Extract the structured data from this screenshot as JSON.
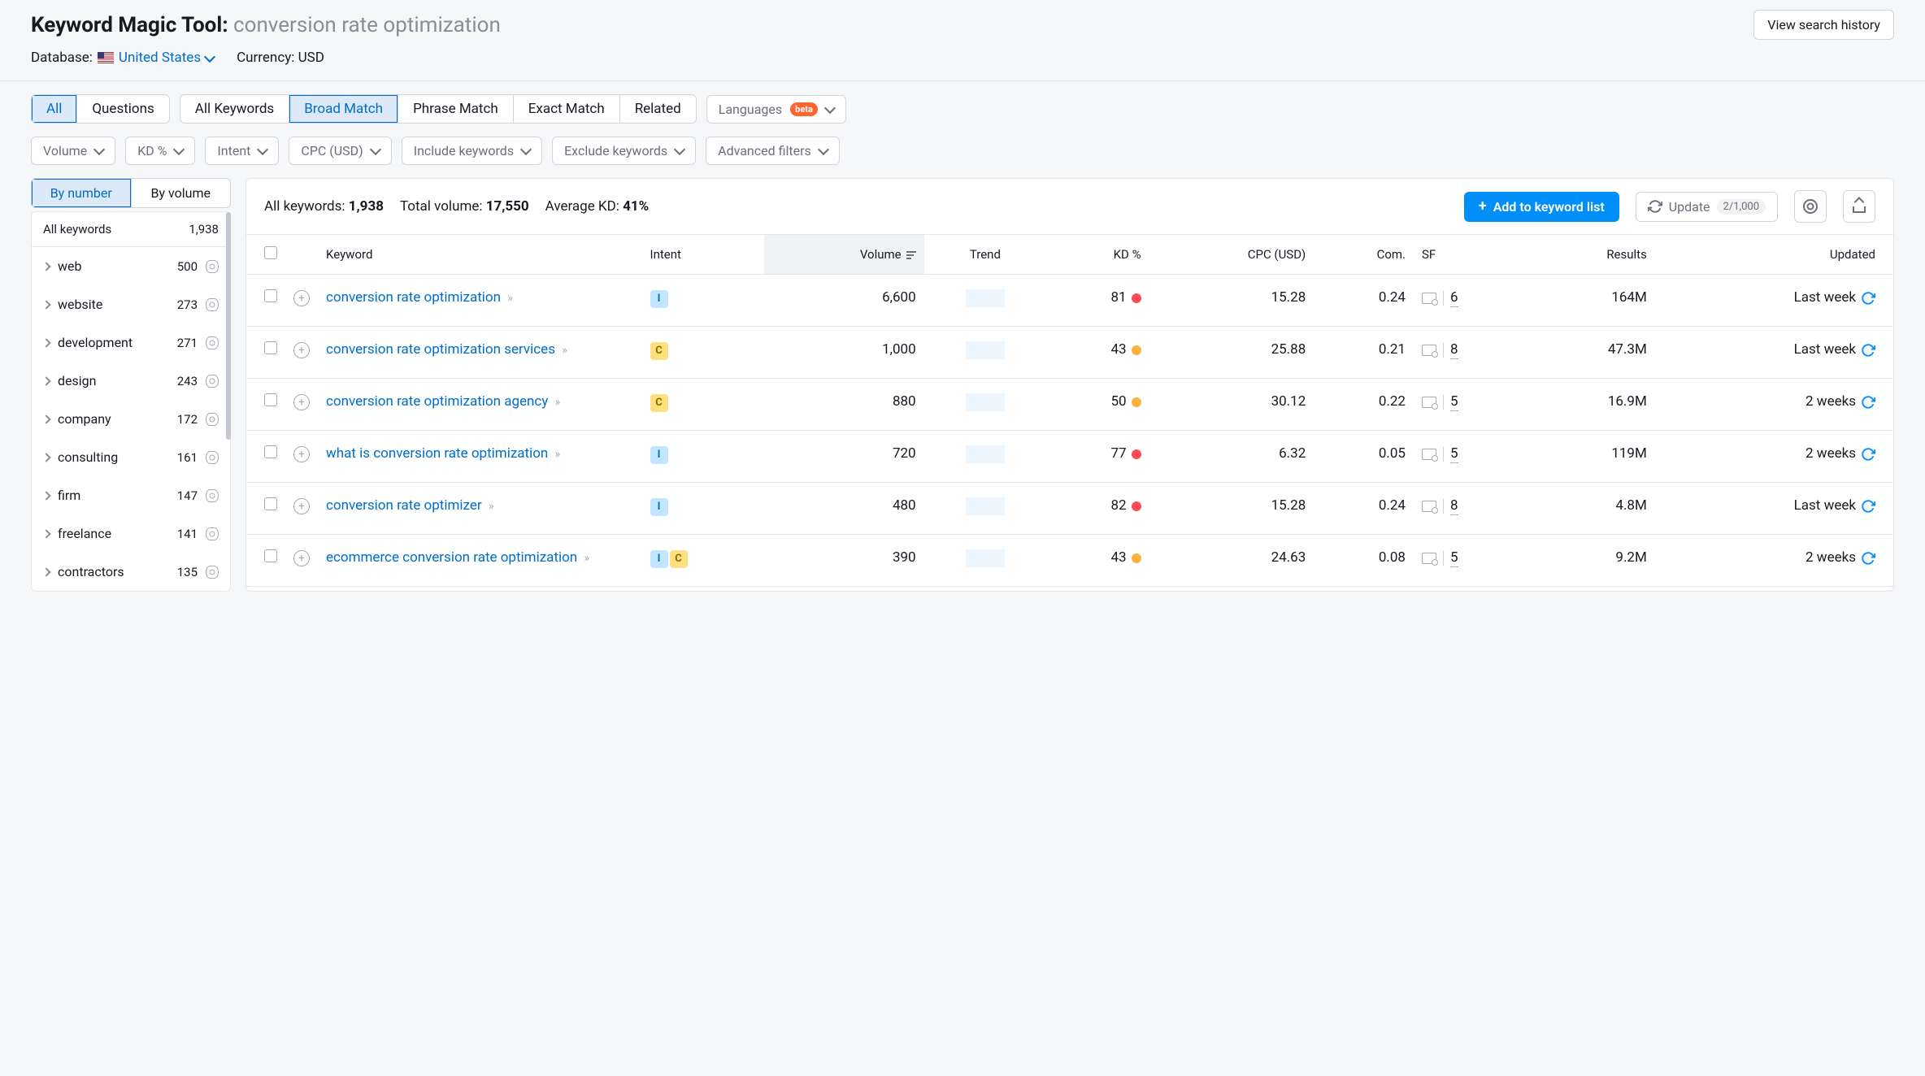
{
  "header": {
    "tool_name": "Keyword Magic Tool:",
    "query": "conversion rate optimization",
    "history_btn": "View search history",
    "database_label": "Database:",
    "database_value": "United States",
    "currency_label": "Currency:",
    "currency_value": "USD"
  },
  "filter_tabs_1": {
    "all": "All",
    "questions": "Questions"
  },
  "filter_tabs_2": {
    "all_kw": "All Keywords",
    "broad": "Broad Match",
    "phrase": "Phrase Match",
    "exact": "Exact Match",
    "related": "Related"
  },
  "lang_dropdown": {
    "label": "Languages",
    "badge": "beta"
  },
  "filter_dropdowns": [
    "Volume",
    "KD %",
    "Intent",
    "CPC (USD)",
    "Include keywords",
    "Exclude keywords",
    "Advanced filters"
  ],
  "sidebar": {
    "seg": {
      "by_number": "By number",
      "by_volume": "By volume"
    },
    "head_label": "All keywords",
    "head_count": "1,938",
    "items": [
      {
        "label": "web",
        "count": "500"
      },
      {
        "label": "website",
        "count": "273"
      },
      {
        "label": "development",
        "count": "271"
      },
      {
        "label": "design",
        "count": "243"
      },
      {
        "label": "company",
        "count": "172"
      },
      {
        "label": "consulting",
        "count": "161"
      },
      {
        "label": "firm",
        "count": "147"
      },
      {
        "label": "freelance",
        "count": "141"
      },
      {
        "label": "contractors",
        "count": "135"
      }
    ]
  },
  "summary": {
    "all_kw_label": "All keywords:",
    "all_kw_val": "1,938",
    "total_vol_label": "Total volume:",
    "total_vol_val": "17,550",
    "avg_kd_label": "Average KD:",
    "avg_kd_val": "41%",
    "add_btn": "Add to keyword list",
    "update_btn": "Update",
    "update_pill": "2/1,000"
  },
  "columns": {
    "keyword": "Keyword",
    "intent": "Intent",
    "volume": "Volume",
    "trend": "Trend",
    "kd": "KD %",
    "cpc": "CPC (USD)",
    "com": "Com.",
    "sf": "SF",
    "results": "Results",
    "updated": "Updated"
  },
  "rows": [
    {
      "keyword": "conversion rate optimization",
      "intent": [
        "I"
      ],
      "volume": "6,600",
      "kd": "81",
      "kd_color": "red",
      "cpc": "15.28",
      "com": "0.24",
      "sf": "6",
      "results": "164M",
      "updated": "Last week"
    },
    {
      "keyword": "conversion rate optimization services",
      "intent": [
        "C"
      ],
      "volume": "1,000",
      "kd": "43",
      "kd_color": "orange",
      "cpc": "25.88",
      "com": "0.21",
      "sf": "8",
      "results": "47.3M",
      "updated": "Last week"
    },
    {
      "keyword": "conversion rate optimization agency",
      "intent": [
        "C"
      ],
      "volume": "880",
      "kd": "50",
      "kd_color": "orange",
      "cpc": "30.12",
      "com": "0.22",
      "sf": "5",
      "results": "16.9M",
      "updated": "2 weeks"
    },
    {
      "keyword": "what is conversion rate optimization",
      "intent": [
        "I"
      ],
      "volume": "720",
      "kd": "77",
      "kd_color": "red",
      "cpc": "6.32",
      "com": "0.05",
      "sf": "5",
      "results": "119M",
      "updated": "2 weeks"
    },
    {
      "keyword": "conversion rate optimizer",
      "intent": [
        "I"
      ],
      "volume": "480",
      "kd": "82",
      "kd_color": "red",
      "cpc": "15.28",
      "com": "0.24",
      "sf": "8",
      "results": "4.8M",
      "updated": "Last week"
    },
    {
      "keyword": "ecommerce conversion rate optimization",
      "intent": [
        "I",
        "C"
      ],
      "volume": "390",
      "kd": "43",
      "kd_color": "orange",
      "cpc": "24.63",
      "com": "0.08",
      "sf": "5",
      "results": "9.2M",
      "updated": "2 weeks"
    }
  ]
}
